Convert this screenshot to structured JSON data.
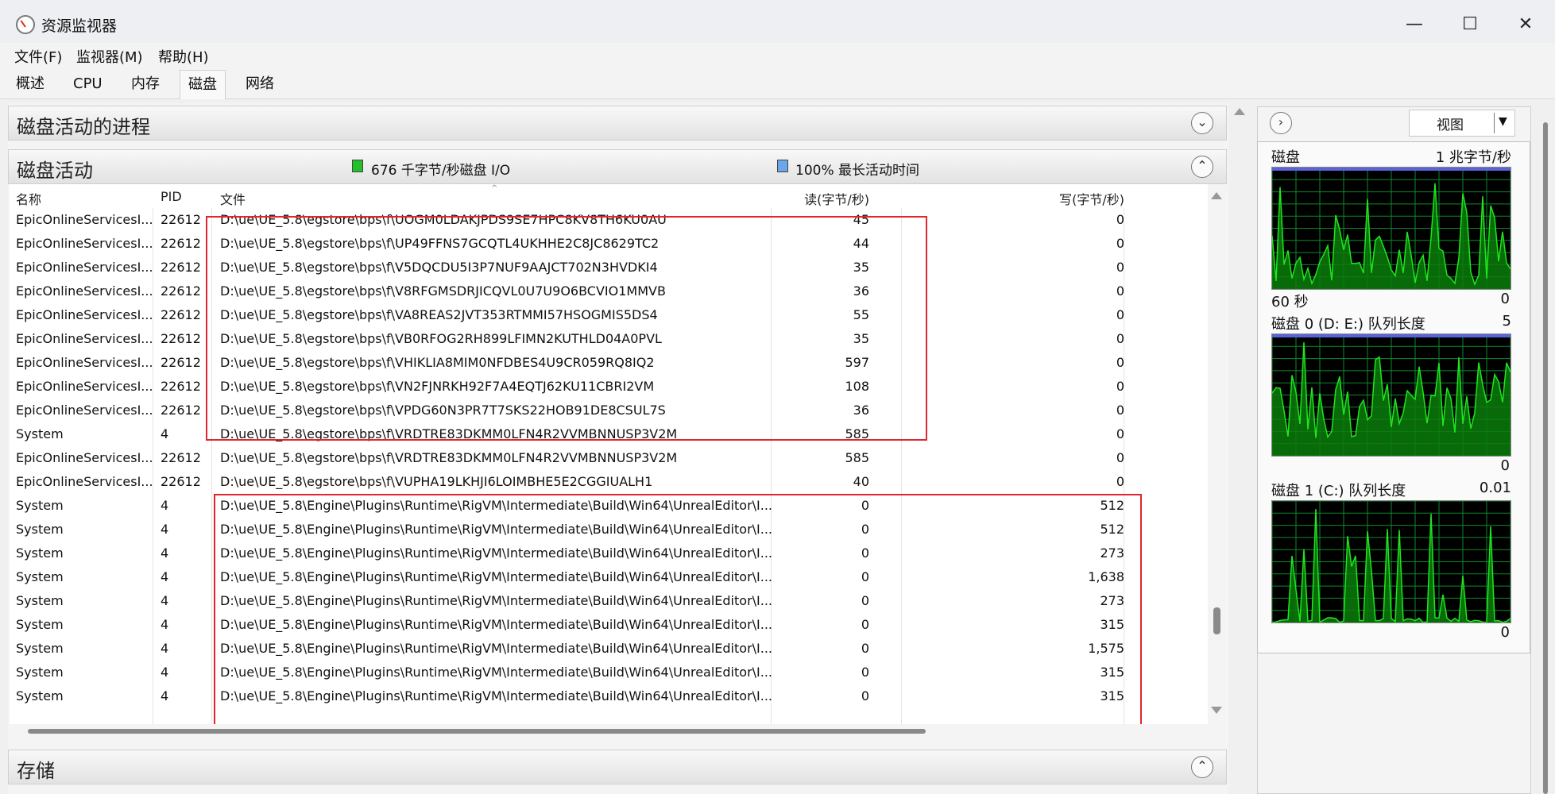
{
  "window": {
    "title": "资源监视器",
    "buttons": {
      "minimize": "—",
      "maximize": "☐",
      "close": "✕"
    }
  },
  "menu": [
    "文件(F)",
    "监视器(M)",
    "帮助(H)"
  ],
  "tabs": [
    "概述",
    "CPU",
    "内存",
    "磁盘",
    "网络"
  ],
  "active_tab": "磁盘",
  "sections": {
    "processes_title": "磁盘活动的进程",
    "activity_title": "磁盘活动",
    "storage_title": "存储"
  },
  "activity_legend": {
    "io_text": "676 千字节/秒磁盘 I/O",
    "io_color": "#22c02a",
    "active_text": "100% 最长活动时间",
    "active_color": "#6aa7e8"
  },
  "table": {
    "columns": [
      "名称",
      "PID",
      "文件",
      "读(字节/秒)",
      "写(字节/秒)"
    ],
    "rows": [
      [
        "EpicOnlineServicesI...",
        "22612",
        "D:\\ue\\UE_5.8\\egstore\\bps\\f\\UOGM0LDAKJPDS9SE7HPC8KV8TH6KU0AU",
        "45",
        "0"
      ],
      [
        "EpicOnlineServicesI...",
        "22612",
        "D:\\ue\\UE_5.8\\egstore\\bps\\f\\UP49FFNS7GCQTL4UKHHE2C8JC8629TC2",
        "44",
        "0"
      ],
      [
        "EpicOnlineServicesI...",
        "22612",
        "D:\\ue\\UE_5.8\\egstore\\bps\\f\\V5DQCDU5I3P7NUF9AAJCT702N3HVDKI4",
        "35",
        "0"
      ],
      [
        "EpicOnlineServicesI...",
        "22612",
        "D:\\ue\\UE_5.8\\egstore\\bps\\f\\V8RFGMSDRJICQVL0U7U9O6BCVIO1MMVB",
        "36",
        "0"
      ],
      [
        "EpicOnlineServicesI...",
        "22612",
        "D:\\ue\\UE_5.8\\egstore\\bps\\f\\VA8REAS2JVT353RTMMI57HSOGMIS5DS4",
        "55",
        "0"
      ],
      [
        "EpicOnlineServicesI...",
        "22612",
        "D:\\ue\\UE_5.8\\egstore\\bps\\f\\VB0RFOG2RH899LFIMN2KUTHLD04A0PVL",
        "35",
        "0"
      ],
      [
        "EpicOnlineServicesI...",
        "22612",
        "D:\\ue\\UE_5.8\\egstore\\bps\\f\\VHIKLIA8MIM0NFDBES4U9CR059RQ8IQ2",
        "597",
        "0"
      ],
      [
        "EpicOnlineServicesI...",
        "22612",
        "D:\\ue\\UE_5.8\\egstore\\bps\\f\\VN2FJNRKH92F7A4EQTJ62KU11CBRI2VM",
        "108",
        "0"
      ],
      [
        "EpicOnlineServicesI...",
        "22612",
        "D:\\ue\\UE_5.8\\egstore\\bps\\f\\VPDG60N3PR7T7SKS22HOB91DE8CSUL7S",
        "36",
        "0"
      ],
      [
        "System",
        "4",
        "D:\\ue\\UE_5.8\\egstore\\bps\\f\\VRDTRE83DKMM0LFN4R2VVMBNNUSP3V2M",
        "585",
        "0"
      ],
      [
        "EpicOnlineServicesI...",
        "22612",
        "D:\\ue\\UE_5.8\\egstore\\bps\\f\\VRDTRE83DKMM0LFN4R2VVMBNNUSP3V2M",
        "585",
        "0"
      ],
      [
        "EpicOnlineServicesI...",
        "22612",
        "D:\\ue\\UE_5.8\\egstore\\bps\\f\\VUPHA19LKHJI6LOIMBHE5E2CGGIUALH1",
        "40",
        "0"
      ],
      [
        "System",
        "4",
        "D:\\ue\\UE_5.8\\Engine\\Plugins\\Runtime\\RigVM\\Intermediate\\Build\\Win64\\UnrealEditor\\I...",
        "0",
        "512"
      ],
      [
        "System",
        "4",
        "D:\\ue\\UE_5.8\\Engine\\Plugins\\Runtime\\RigVM\\Intermediate\\Build\\Win64\\UnrealEditor\\I...",
        "0",
        "512"
      ],
      [
        "System",
        "4",
        "D:\\ue\\UE_5.8\\Engine\\Plugins\\Runtime\\RigVM\\Intermediate\\Build\\Win64\\UnrealEditor\\I...",
        "0",
        "273"
      ],
      [
        "System",
        "4",
        "D:\\ue\\UE_5.8\\Engine\\Plugins\\Runtime\\RigVM\\Intermediate\\Build\\Win64\\UnrealEditor\\I...",
        "0",
        "1,638"
      ],
      [
        "System",
        "4",
        "D:\\ue\\UE_5.8\\Engine\\Plugins\\Runtime\\RigVM\\Intermediate\\Build\\Win64\\UnrealEditor\\I...",
        "0",
        "273"
      ],
      [
        "System",
        "4",
        "D:\\ue\\UE_5.8\\Engine\\Plugins\\Runtime\\RigVM\\Intermediate\\Build\\Win64\\UnrealEditor\\I...",
        "0",
        "315"
      ],
      [
        "System",
        "4",
        "D:\\ue\\UE_5.8\\Engine\\Plugins\\Runtime\\RigVM\\Intermediate\\Build\\Win64\\UnrealEditor\\I...",
        "0",
        "1,575"
      ],
      [
        "System",
        "4",
        "D:\\ue\\UE_5.8\\Engine\\Plugins\\Runtime\\RigVM\\Intermediate\\Build\\Win64\\UnrealEditor\\I...",
        "0",
        "315"
      ],
      [
        "System",
        "4",
        "D:\\ue\\UE_5.8\\Engine\\Plugins\\Runtime\\RigVM\\Intermediate\\Build\\Win64\\UnrealEditor\\I...",
        "0",
        "315"
      ]
    ]
  },
  "right_panel": {
    "view_label": "视图",
    "graphs": [
      {
        "title": "磁盘",
        "max_label": "1 兆字节/秒",
        "left_bottom": "60 秒",
        "right_bottom": "0"
      },
      {
        "title": "磁盘 0 (D: E:) 队列长度",
        "max_label": "5",
        "left_bottom": "",
        "right_bottom": "0"
      },
      {
        "title": "磁盘 1 (C:) 队列长度",
        "max_label": "0.01",
        "left_bottom": "",
        "right_bottom": "0"
      }
    ],
    "graph_colors": {
      "line": "#1ee61e",
      "fill": "#0a7d0a",
      "grid": "#0c8a2b",
      "cap": "#5a63d8"
    }
  }
}
